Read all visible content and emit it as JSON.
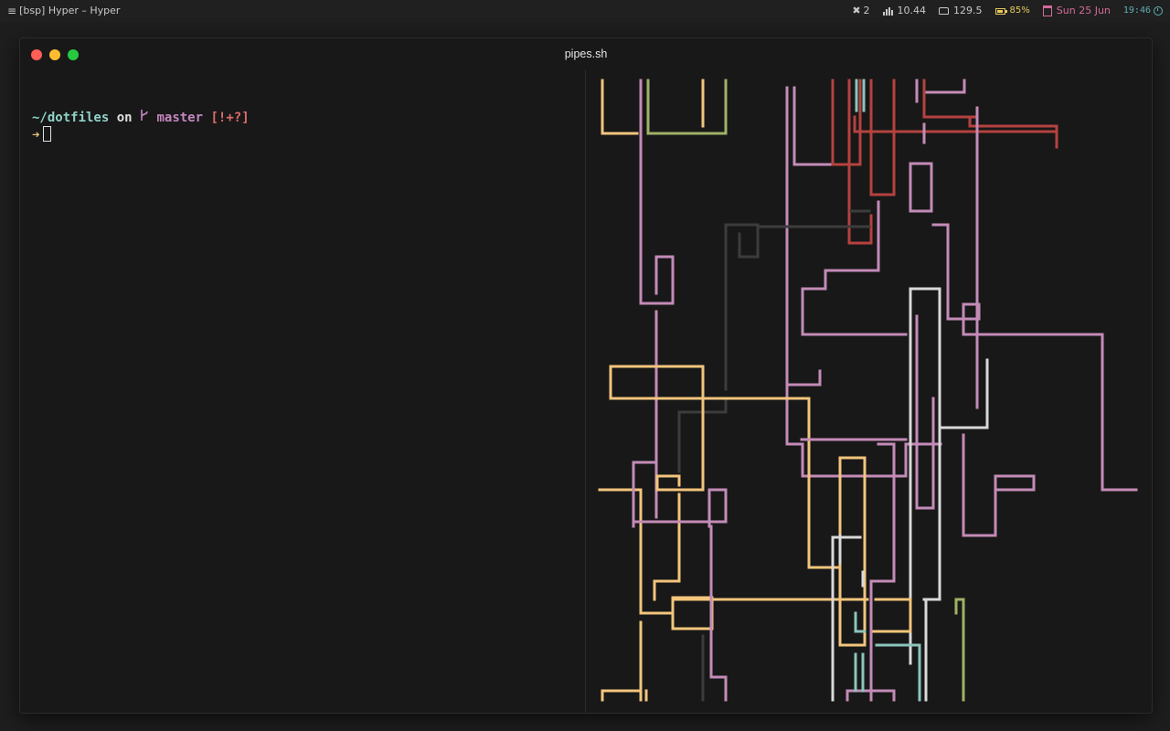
{
  "topbar": {
    "left_label": "[bsp] Hyper – Hyper",
    "desktops": "2",
    "load": "10.44",
    "disk": "129.5",
    "battery": "85%",
    "date": "Sun 25 Jun",
    "time": "19:46"
  },
  "colors": {
    "battery": "#e6c95a",
    "date": "#d46b9a",
    "time": "#5db0b4"
  },
  "window": {
    "title": "pipes.sh"
  },
  "terminal": {
    "path": "~/dotfiles",
    "on": "on",
    "branch": "master",
    "status": "[!+?]",
    "prompt": "➜"
  },
  "pipes": {
    "colors": {
      "pink": "#c48bb8",
      "yellow": "#f2c57c",
      "red": "#b5423f",
      "green": "#9fb266",
      "teal": "#8cc5bb",
      "white": "#d9d9d9",
      "gray": "#3c3c3c"
    }
  }
}
